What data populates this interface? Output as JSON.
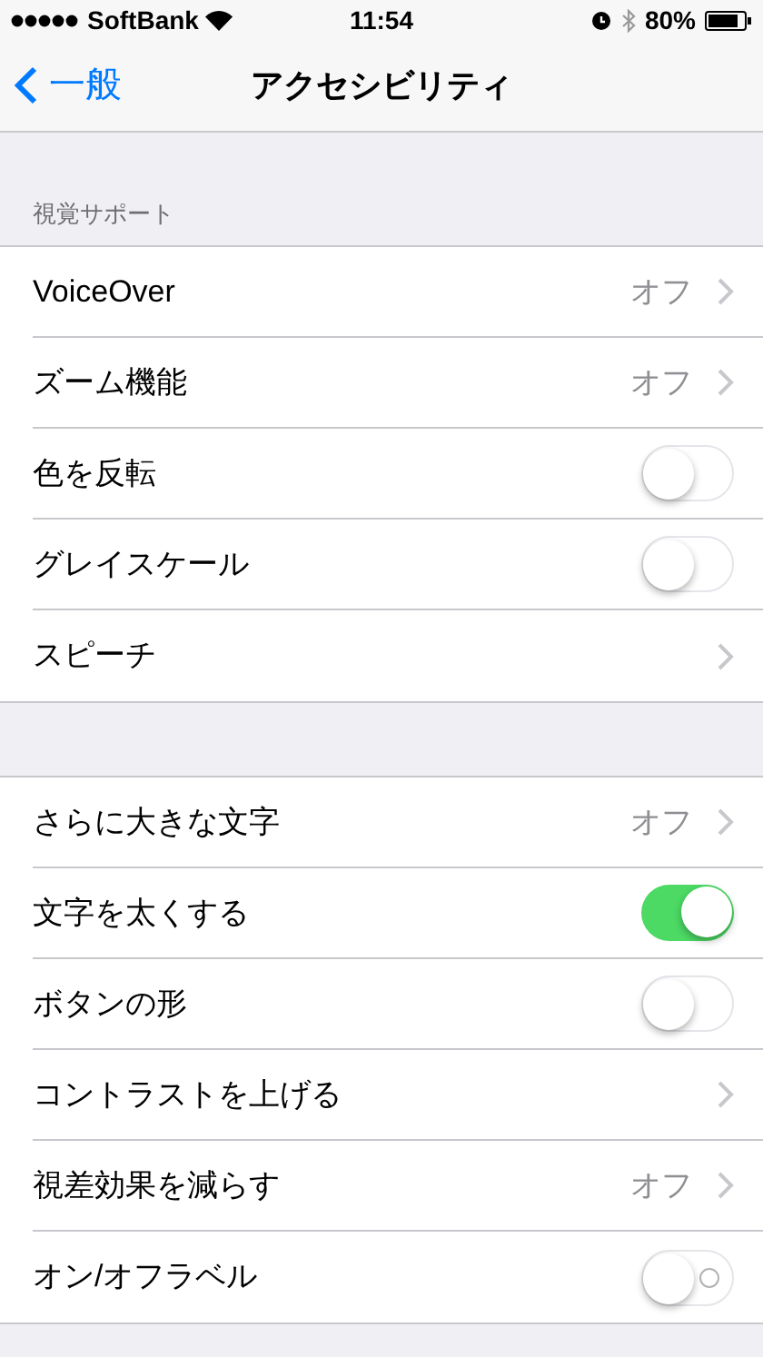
{
  "status_bar": {
    "carrier": "SoftBank",
    "time": "11:54",
    "battery": "80%"
  },
  "nav": {
    "back": "一般",
    "title": "アクセシビリティ"
  },
  "sections": [
    {
      "header": "視覚サポート",
      "rows": [
        {
          "kind": "detail",
          "label": "VoiceOver",
          "value": "オフ"
        },
        {
          "kind": "detail",
          "label": "ズーム機能",
          "value": "オフ"
        },
        {
          "kind": "toggle",
          "label": "色を反転",
          "on": false,
          "off_label": false
        },
        {
          "kind": "toggle",
          "label": "グレイスケール",
          "on": false,
          "off_label": false
        },
        {
          "kind": "link",
          "label": "スピーチ"
        }
      ]
    },
    {
      "rows": [
        {
          "kind": "detail",
          "label": "さらに大きな文字",
          "value": "オフ"
        },
        {
          "kind": "toggle",
          "label": "文字を太くする",
          "on": true,
          "off_label": false
        },
        {
          "kind": "toggle",
          "label": "ボタンの形",
          "on": false,
          "off_label": false
        },
        {
          "kind": "link",
          "label": "コントラストを上げる"
        },
        {
          "kind": "detail",
          "label": "視差効果を減らす",
          "value": "オフ"
        },
        {
          "kind": "toggle",
          "label": "オン/オフラベル",
          "on": false,
          "off_label": true
        }
      ]
    }
  ]
}
